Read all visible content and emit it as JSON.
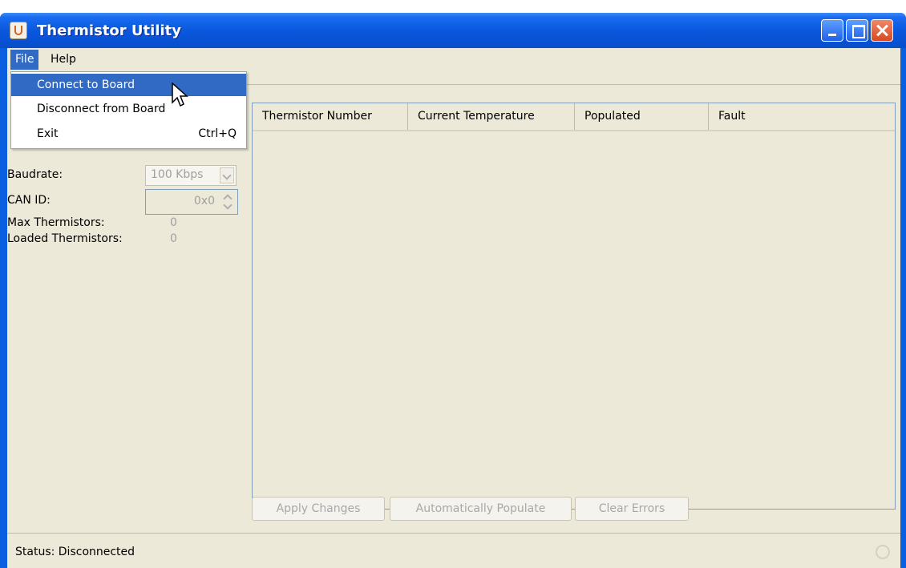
{
  "window": {
    "title": "Thermistor Utility"
  },
  "menubar": {
    "file": "File",
    "help": "Help"
  },
  "file_menu": {
    "items": [
      {
        "label": "Connect to Board",
        "shortcut": "",
        "highlighted": true
      },
      {
        "label": "Disconnect from Board",
        "shortcut": ""
      },
      {
        "label": "Exit",
        "shortcut": "Ctrl+Q"
      }
    ]
  },
  "settings": {
    "baudrate_label": "Baudrate:",
    "baudrate_value": "100 Kbps",
    "can_id_label": "CAN ID:",
    "can_id_value": "0x0",
    "max_thermistors_label": "Max Thermistors:",
    "max_thermistors_value": "0",
    "loaded_thermistors_label": "Loaded Thermistors:",
    "loaded_thermistors_value": "0"
  },
  "table": {
    "columns": [
      "Thermistor Number",
      "Current Temperature",
      "Populated",
      "Fault"
    ],
    "rows": []
  },
  "buttons": {
    "apply": "Apply Changes",
    "auto_populate": "Automatically Populate",
    "clear_errors": "Clear Errors"
  },
  "status": {
    "text": "Status: Disconnected"
  },
  "colors": {
    "title_bar": "#0a58de",
    "menu_highlight": "#316ac5",
    "window_background": "#ece9d8",
    "disabled_text": "#a0a0a0"
  }
}
